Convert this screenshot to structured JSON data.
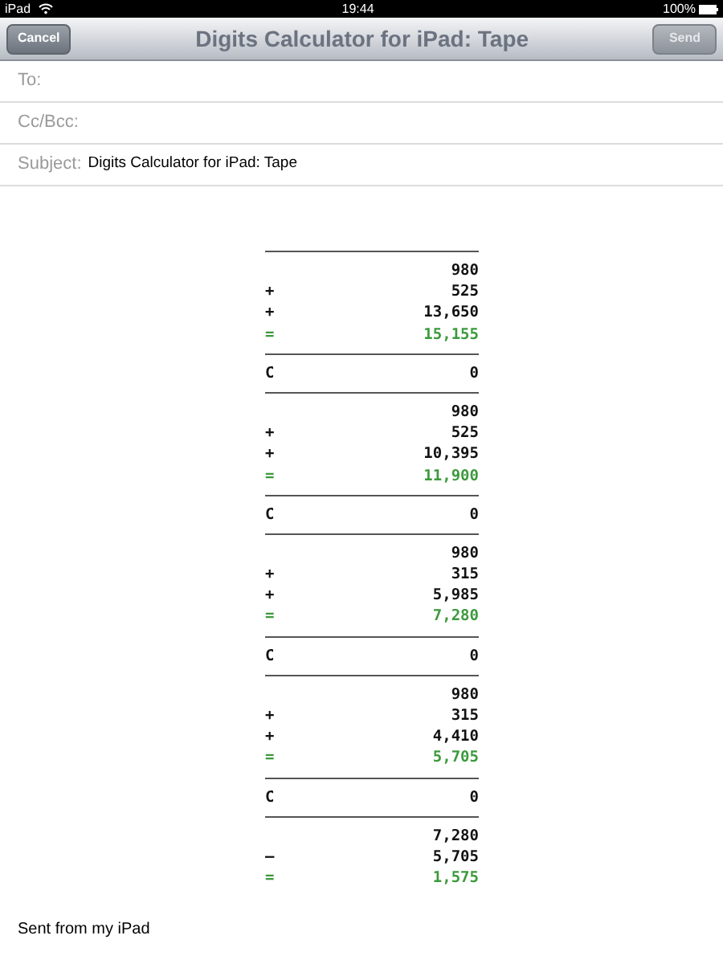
{
  "status_bar": {
    "device": "iPad",
    "time": "19:44",
    "battery": "100%"
  },
  "nav": {
    "title": "Digits Calculator for iPad: Tape",
    "cancel": "Cancel",
    "send": "Send"
  },
  "fields": [
    {
      "label": "To:"
    },
    {
      "label": "Cc/Bcc:"
    },
    {
      "label": "Subject:",
      "value": "Digits Calculator for iPad: Tape"
    }
  ],
  "tape": [
    {
      "kind": "rule"
    },
    {
      "kind": "entry",
      "value": "980"
    },
    {
      "kind": "entry",
      "op": "+",
      "value": "525"
    },
    {
      "kind": "entry",
      "op": "+",
      "value": "13,650"
    },
    {
      "kind": "total",
      "op": "=",
      "value": "15,155"
    },
    {
      "kind": "rule"
    },
    {
      "kind": "entry",
      "op": "C",
      "value": "0"
    },
    {
      "kind": "rule"
    },
    {
      "kind": "entry",
      "value": "980"
    },
    {
      "kind": "entry",
      "op": "+",
      "value": "525"
    },
    {
      "kind": "entry",
      "op": "+",
      "value": "10,395"
    },
    {
      "kind": "total",
      "op": "=",
      "value": "11,900"
    },
    {
      "kind": "rule"
    },
    {
      "kind": "entry",
      "op": "C",
      "value": "0"
    },
    {
      "kind": "rule"
    },
    {
      "kind": "entry",
      "value": "980"
    },
    {
      "kind": "entry",
      "op": "+",
      "value": "315"
    },
    {
      "kind": "entry",
      "op": "+",
      "value": "5,985"
    },
    {
      "kind": "total",
      "op": "=",
      "value": "7,280"
    },
    {
      "kind": "rule"
    },
    {
      "kind": "entry",
      "op": "C",
      "value": "0"
    },
    {
      "kind": "rule"
    },
    {
      "kind": "entry",
      "value": "980"
    },
    {
      "kind": "entry",
      "op": "+",
      "value": "315"
    },
    {
      "kind": "entry",
      "op": "+",
      "value": "4,410"
    },
    {
      "kind": "total",
      "op": "=",
      "value": "5,705"
    },
    {
      "kind": "rule"
    },
    {
      "kind": "entry",
      "op": "C",
      "value": "0"
    },
    {
      "kind": "rule"
    },
    {
      "kind": "entry",
      "value": "7,280"
    },
    {
      "kind": "entry",
      "op": "–",
      "value": "5,705"
    },
    {
      "kind": "total",
      "op": "=",
      "value": "1,575"
    }
  ],
  "signature": "Sent from my iPad"
}
